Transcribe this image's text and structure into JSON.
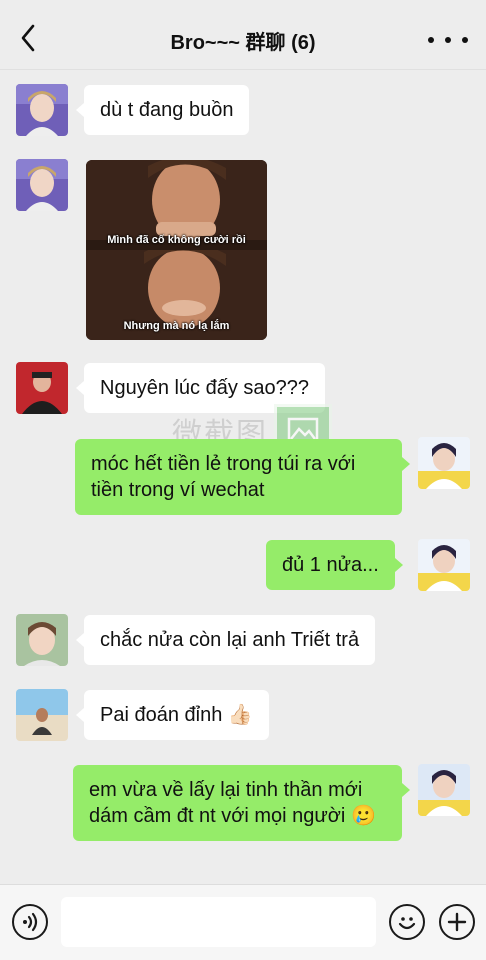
{
  "header": {
    "title": "Bro~~~ 群聊 (6)",
    "back_icon": "chevron-left-icon",
    "more_icon": "more-dots-icon"
  },
  "messages": [
    {
      "side": "in",
      "text": "dù t đang buồn"
    },
    {
      "side": "in",
      "type": "image",
      "caption_top": "Mình đã cố không cười rồi",
      "caption_bottom": "Nhưng mà nó lạ lắm"
    },
    {
      "side": "in",
      "text": "Nguyên lúc đấy sao???"
    },
    {
      "side": "out",
      "text": "móc hết tiền lẻ trong túi ra với tiền trong ví wechat"
    },
    {
      "side": "out",
      "text": "đủ 1 nửa..."
    },
    {
      "side": "in",
      "text": "chắc nửa còn lại anh Triết trả"
    },
    {
      "side": "in",
      "text": "Pai đoán đỉnh",
      "emoji": "👍🏻"
    },
    {
      "side": "out",
      "text": "em vừa về lấy lại tinh thần mới dám cầm đt nt với mọi người",
      "emoji": "🥲"
    }
  ],
  "watermark": {
    "text": "微截图"
  },
  "input_bar": {
    "voice_icon": "voice-icon",
    "input_value": "",
    "emoji_icon": "emoji-icon",
    "plus_icon": "plus-icon"
  },
  "colors": {
    "background": "#ededed",
    "outgoing_bubble": "#95ec69",
    "incoming_bubble": "#ffffff"
  }
}
